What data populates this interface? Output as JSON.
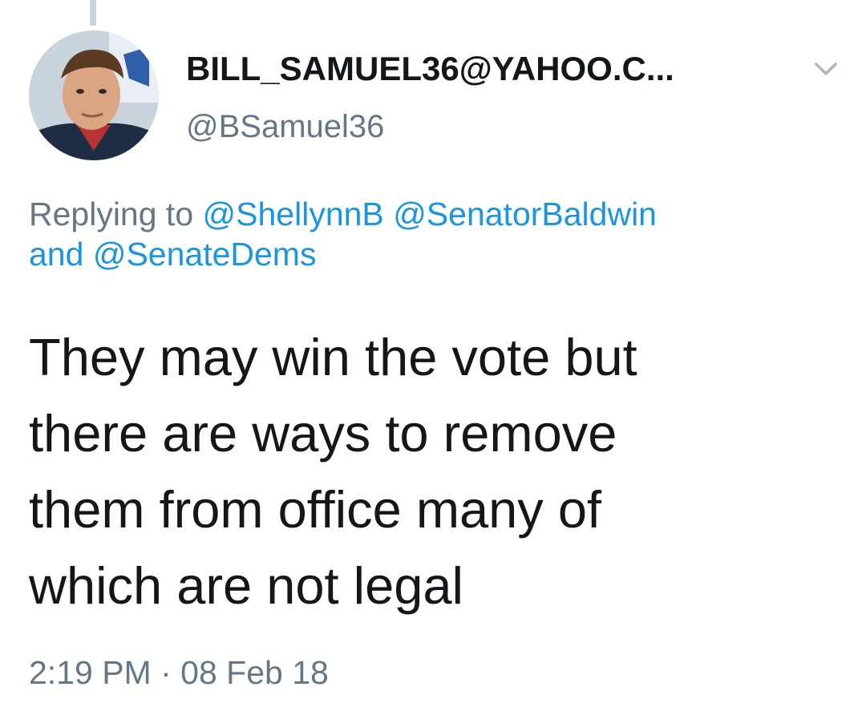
{
  "tweet": {
    "author": {
      "display_name": "BILL_SAMUEL36@YAHOO.C...",
      "handle": "@BSamuel36",
      "avatar": "profile-photo"
    },
    "menu_icon": "chevron-down-icon",
    "reply_context": {
      "prefix": "Replying to",
      "mentions": [
        "@ShellynnB",
        "@SenatorBaldwin",
        "@SenateDems"
      ],
      "conjunction": "and"
    },
    "text_lines": [
      "They may win the vote but",
      "there are ways to remove",
      "them from office many of",
      "which are not legal"
    ],
    "time": "2:19 PM",
    "separator": "·",
    "date": "08 Feb 18"
  },
  "colors": {
    "text": "#14171a",
    "secondary": "#657786",
    "link": "#1b95e0",
    "thread_line": "#ccd6dd"
  }
}
